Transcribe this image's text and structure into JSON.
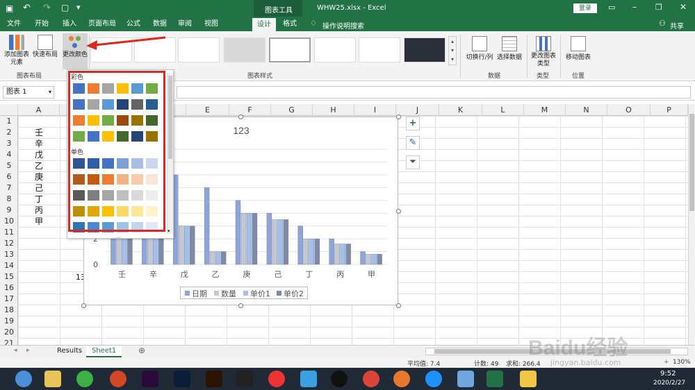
{
  "titlebar": {
    "tools_label": "图表工具",
    "filename": "WHW25.xlsx - Excel",
    "login": "登录"
  },
  "tabs": [
    "文件",
    "开始",
    "插入",
    "页面布局",
    "公式",
    "数据",
    "审阅",
    "视图",
    "设计",
    "格式"
  ],
  "tell_me": "操作说明搜索",
  "share": "共享",
  "ribbon": {
    "add_element": "添加图表元素",
    "quick_layout": "快速布局",
    "change_colors": "更改颜色",
    "group_layout": "图表布局",
    "group_styles": "图表样式",
    "switch_rowcol": "切换行/列",
    "select_data": "选择数据",
    "group_data": "数据",
    "change_type": "更改图表类型",
    "group_type": "类型",
    "move_chart": "移动图表",
    "group_location": "位置"
  },
  "namebox": "图表 1",
  "columns": [
    "A",
    "B",
    "C",
    "D",
    "E",
    "F",
    "G",
    "H",
    "I",
    "J",
    "K",
    "L",
    "M",
    "N",
    "O",
    "P"
  ],
  "rows": [
    "1",
    "2",
    "3",
    "4",
    "5",
    "6",
    "7",
    "8",
    "9",
    "10",
    "11",
    "12",
    "13",
    "14",
    "15",
    "16",
    "17",
    "18",
    "19",
    "20",
    "21"
  ],
  "cells_a": [
    "壬",
    "辛",
    "戊",
    "乙",
    "庚",
    "己",
    "丁",
    "丙",
    "甲"
  ],
  "cell_b15": "13",
  "palette": {
    "colorful_label": "彩色",
    "mono_label": "单色",
    "colorful_rows": [
      [
        "#4472c4",
        "#ed7d31",
        "#a5a5a5",
        "#ffc000",
        "#5b9bd5",
        "#70ad47"
      ],
      [
        "#4472c4",
        "#a5a5a5",
        "#5b9bd5",
        "#264478",
        "#636363",
        "#255e91"
      ],
      [
        "#ed7d31",
        "#ffc000",
        "#70ad47",
        "#9e480e",
        "#997300",
        "#43682b"
      ],
      [
        "#70ad47",
        "#4472c4",
        "#ffc000",
        "#43682b",
        "#264478",
        "#997300"
      ]
    ],
    "mono_rows": [
      [
        "#2f5597",
        "#2e5ea8",
        "#4472c4",
        "#7f9fd8",
        "#a9bde5",
        "#cdd8f0"
      ],
      [
        "#b35a1f",
        "#c55a11",
        "#ed7d31",
        "#f4b183",
        "#f8cbad",
        "#fbe5d6"
      ],
      [
        "#595959",
        "#7f7f7f",
        "#a5a5a5",
        "#bfbfbf",
        "#d9d9d9",
        "#ededed"
      ],
      [
        "#bf8f00",
        "#e0a800",
        "#ffc000",
        "#ffd966",
        "#ffe699",
        "#fff2cc"
      ],
      [
        "#2e75b6",
        "#4a8ad0",
        "#5b9bd5",
        "#9dc3e6",
        "#bdd7ee",
        "#deebf7"
      ]
    ]
  },
  "chart_data": {
    "type": "bar",
    "title": "123",
    "categories": [
      "壬",
      "辛",
      "戊",
      "乙",
      "庚",
      "己",
      "丁",
      "丙",
      "甲"
    ],
    "series": [
      {
        "name": "日期",
        "values": [
          9,
          8,
          7,
          6,
          5,
          4,
          3,
          2,
          1
        ]
      },
      {
        "name": "数量",
        "values": [
          6,
          6,
          3,
          1,
          4,
          3.5,
          2,
          1.6,
          0.8
        ]
      },
      {
        "name": "单价1",
        "values": [
          6,
          6,
          3,
          1,
          4,
          3.5,
          2,
          1.6,
          0.8
        ]
      },
      {
        "name": "单价2",
        "values": [
          6,
          6,
          3,
          1,
          4,
          3.5,
          2,
          1.6,
          0.8
        ]
      }
    ],
    "colors": [
      "#8fa5d8",
      "#c5c8cf",
      "#a5c0e6",
      "#7e8aa6"
    ],
    "visible_yticks": [
      "0",
      "2"
    ],
    "ylim": [
      0,
      9
    ]
  },
  "sheets": [
    "Results",
    "Sheet1"
  ],
  "status": {
    "avg": "平均值: 7.4",
    "count": "计数: 49",
    "sum": "求和: 266.4",
    "zoom": "130%"
  },
  "clock": {
    "time": "9:52",
    "date": "2020/2/27"
  },
  "watermark": "Baidu经验",
  "watermark_url": "jingyan.baidu.com"
}
